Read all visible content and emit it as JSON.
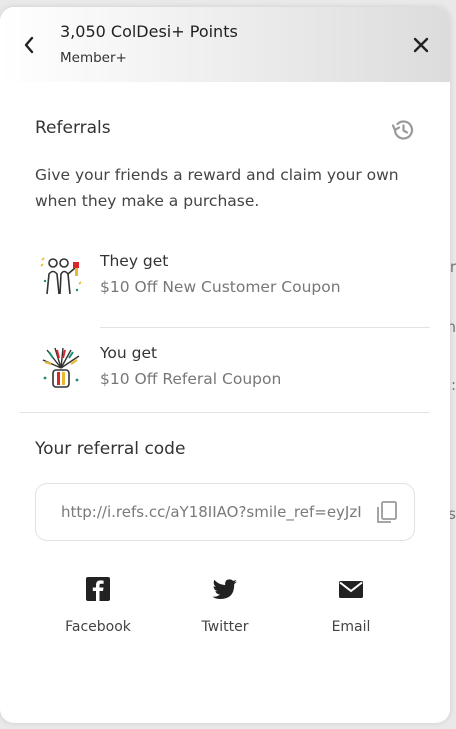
{
  "header": {
    "points_title": "3,050 ColDesi+ Points",
    "tier": "Member+"
  },
  "referrals": {
    "title": "Referrals",
    "intro": "Give your friends a reward and claim your own when they make a purchase.",
    "rewards": [
      {
        "label": "They get",
        "value": "$10 Off New Customer Coupon",
        "icon": "friends-celebrating-icon"
      },
      {
        "label": "You get",
        "value": "$10 Off Referal Coupon",
        "icon": "party-popper-icon"
      }
    ]
  },
  "referral_code": {
    "title": "Your referral code",
    "value": "http://i.refs.cc/aY18IIAO?smile_ref=eyJzI"
  },
  "share": [
    {
      "label": "Facebook",
      "icon": "facebook-icon"
    },
    {
      "label": "Twitter",
      "icon": "twitter-icon"
    },
    {
      "label": "Email",
      "icon": "email-icon"
    }
  ],
  "colors": {
    "text_primary": "#333333",
    "text_muted": "#777777",
    "divider": "#e3e3e3"
  }
}
